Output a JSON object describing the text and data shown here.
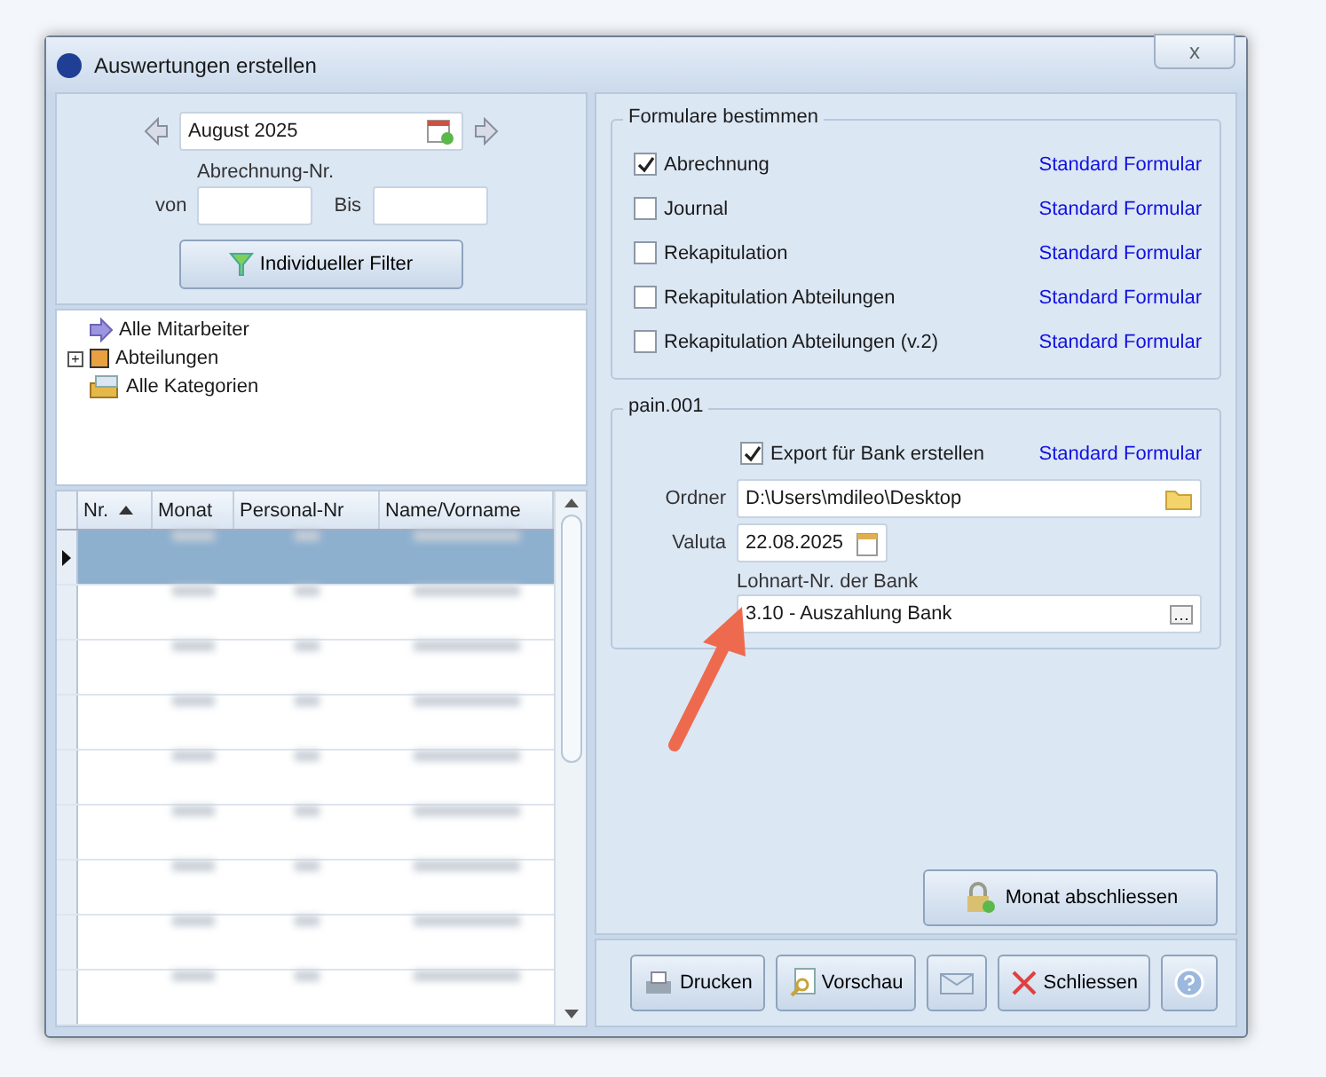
{
  "window": {
    "title": "Auswertungen erstellen",
    "close_label": "x"
  },
  "period": {
    "month": "August 2025",
    "number_label": "Abrechnung-Nr.",
    "from_label": "von",
    "to_label": "Bis",
    "filter_button": "Individueller Filter"
  },
  "tree": [
    {
      "kind": "arrow",
      "label": "Alle Mitarbeiter"
    },
    {
      "kind": "square",
      "label": "Abteilungen",
      "toggle": "+"
    },
    {
      "kind": "box",
      "label": "Alle Kategorien"
    }
  ],
  "table": {
    "columns": [
      {
        "label": "Nr.",
        "sorted": true
      },
      {
        "label": "Monat",
        "sorted": false
      },
      {
        "label": "Personal-Nr",
        "sorted": false
      },
      {
        "label": "Name/Vorname",
        "sorted": false
      }
    ],
    "rows": [
      {
        "selected": true
      },
      {
        "selected": false
      },
      {
        "selected": false
      },
      {
        "selected": false
      },
      {
        "selected": false
      },
      {
        "selected": false
      },
      {
        "selected": false
      },
      {
        "selected": false
      },
      {
        "selected": false
      }
    ]
  },
  "forms": {
    "title": "Formulare bestimmen",
    "items": [
      {
        "label": "Abrechnung",
        "checked": true,
        "link": "Standard Formular"
      },
      {
        "label": "Journal",
        "checked": false,
        "link": "Standard Formular"
      },
      {
        "label": "Rekapitulation",
        "checked": false,
        "link": "Standard Formular"
      },
      {
        "label": "Rekapitulation Abteilungen",
        "checked": false,
        "link": "Standard Formular"
      },
      {
        "label": "Rekapitulation Abteilungen (v.2)",
        "checked": false,
        "link": "Standard Formular"
      }
    ]
  },
  "pain": {
    "title": "pain.001",
    "export_label": "Export für Bank erstellen",
    "export_checked": true,
    "export_link": "Standard Formular",
    "folder_label": "Ordner",
    "folder_value": "D:\\Users\\mdileo\\Desktop",
    "valuta_label": "Valuta",
    "valuta_value": "22.08.2025",
    "bank_label": "Lohnart-Nr. der Bank",
    "bank_value": "3.10 - Auszahlung Bank"
  },
  "close_month_button": "Monat abschliessen",
  "buttons": [
    {
      "kind": "print",
      "label": "Drucken"
    },
    {
      "kind": "preview",
      "label": "Vorschau"
    },
    {
      "kind": "mail"
    },
    {
      "kind": "close",
      "label": "Schliessen"
    },
    {
      "kind": "help"
    }
  ]
}
